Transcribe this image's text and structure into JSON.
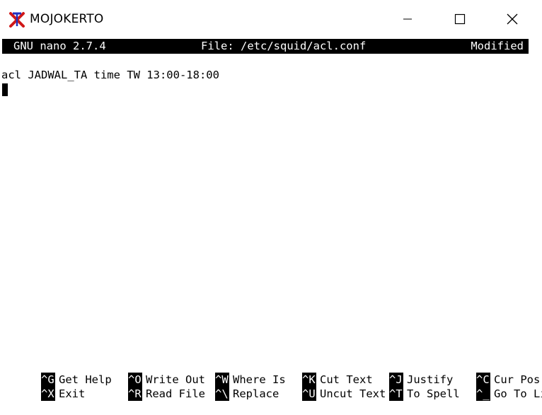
{
  "window": {
    "title": "MOJOKERTO",
    "icons": {
      "app": "putty-app-icon",
      "minimize": "minimize-icon",
      "maximize": "maximize-icon",
      "close": "close-icon"
    }
  },
  "nano": {
    "version": "GNU nano 2.7.4",
    "file": "File: /etc/squid/acl.conf",
    "status": "Modified"
  },
  "editor": {
    "lines": [
      "acl JADWAL_TA time TW 13:00-18:00"
    ]
  },
  "shortcuts": {
    "row1": [
      {
        "key": "^G",
        "label": "Get Help"
      },
      {
        "key": "^O",
        "label": "Write Out"
      },
      {
        "key": "^W",
        "label": "Where Is"
      },
      {
        "key": "^K",
        "label": "Cut Text"
      },
      {
        "key": "^J",
        "label": "Justify"
      },
      {
        "key": "^C",
        "label": "Cur Pos"
      }
    ],
    "row2": [
      {
        "key": "^X",
        "label": "Exit"
      },
      {
        "key": "^R",
        "label": "Read File"
      },
      {
        "key": "^\\",
        "label": "Replace"
      },
      {
        "key": "^U",
        "label": "Uncut Text"
      },
      {
        "key": "^T",
        "label": "To Spell"
      },
      {
        "key": "^_",
        "label": "Go To Line"
      }
    ]
  }
}
